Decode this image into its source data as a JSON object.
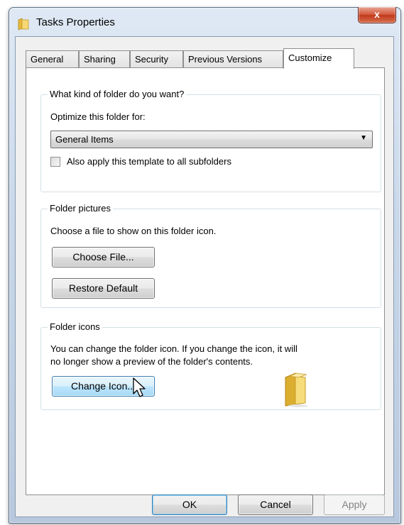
{
  "window": {
    "title": "Tasks Properties",
    "close_glyph": "x"
  },
  "tabs": [
    {
      "label": "General"
    },
    {
      "label": "Sharing"
    },
    {
      "label": "Security"
    },
    {
      "label": "Previous Versions"
    },
    {
      "label": "Customize",
      "active": true
    }
  ],
  "folder_type": {
    "legend": "What kind of folder do you want?",
    "optimize_label": "Optimize this folder for:",
    "selected_option": "General Items",
    "apply_subfolders_label": "Also apply this template to all subfolders",
    "apply_subfolders_checked": false
  },
  "folder_pictures": {
    "legend": "Folder pictures",
    "description": "Choose a file to show on this folder icon.",
    "choose_file_label": "Choose File...",
    "restore_default_label": "Restore Default"
  },
  "folder_icons": {
    "legend": "Folder icons",
    "description_line1": "You can change the folder icon. If you change the icon, it will",
    "description_line2": "no longer show a preview of the folder's contents.",
    "change_icon_label": "Change Icon..."
  },
  "footer": {
    "ok_label": "OK",
    "cancel_label": "Cancel",
    "apply_label": "Apply"
  },
  "icons": {
    "title": "folder-icon",
    "preview": "folder-icon",
    "pointer": "mouse-pointer-icon"
  },
  "colors": {
    "accent_blue": "#3c7fb1",
    "close_red": "#c1391b",
    "folder_yellow": "#f2c94c"
  }
}
